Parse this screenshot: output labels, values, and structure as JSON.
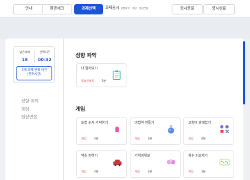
{
  "steps": [
    {
      "label": "안내"
    },
    {
      "label": "환경체크"
    },
    {
      "label": "과제선택"
    },
    {
      "label": "과제응시",
      "sub": "성향파악 · 게임 · 영상면접"
    },
    {
      "label": "응시종료"
    },
    {
      "label": "응시완료"
    }
  ],
  "side": {
    "remaining_label": "남은과제",
    "time_label": "선택시간",
    "remaining_value": "18",
    "time_value": "00:32",
    "rest_button_line1": "5개 과제 완료 이전",
    "rest_button_line2": "(잔여시간)",
    "nav": [
      "성향 파악",
      "게임",
      "영상면접"
    ]
  },
  "sections": {
    "personality": {
      "title": "성향 파악",
      "card": {
        "title": "나 알아보기",
        "tag": "필요이해도",
        "time": "3분",
        "icon": "clipboard-icon"
      }
    },
    "game": {
      "title": "게임",
      "cards": [
        {
          "title": "도형 순서 기억하기",
          "tag": "게임",
          "time": "4분",
          "icon": "shapes-sequence-icon"
        },
        {
          "title": "마법약 만들기",
          "tag": "게임",
          "time": "3분",
          "icon": "potion-icon"
        },
        {
          "title": "고양이 술래잡기",
          "tag": "게임",
          "time": "4분",
          "icon": "cat-grid-icon"
        },
        {
          "title": "약속 정하기",
          "tag": "게임",
          "time": "4분",
          "icon": "car-icon"
        },
        {
          "title": "가위바위보",
          "tag": "게임",
          "time": "3분",
          "icon": "rock-paper-scissors-icon"
        },
        {
          "title": "개수 비교하기",
          "tag": "게임",
          "time": "3분",
          "icon": "count-compare-icon"
        }
      ]
    }
  },
  "colors": {
    "accent": "#1b55d6",
    "tag": "#e0514a"
  }
}
